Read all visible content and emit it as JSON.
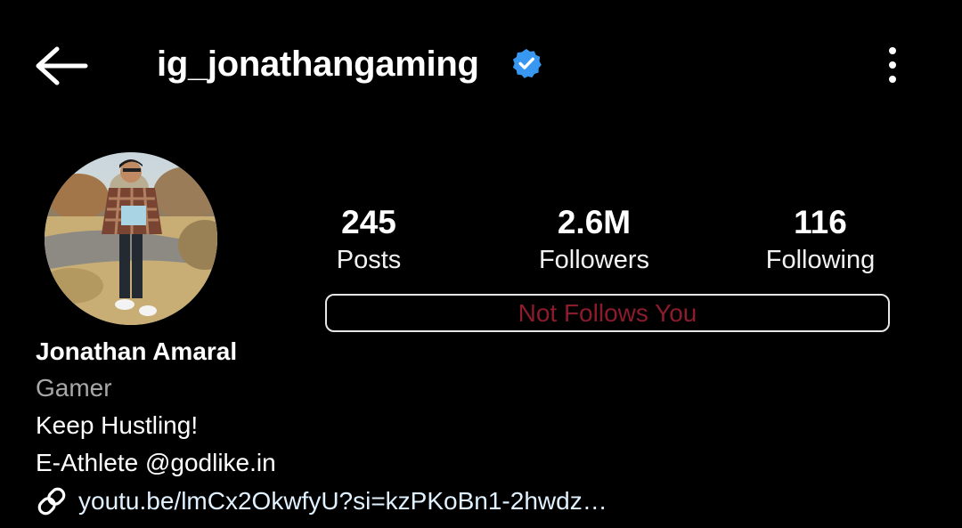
{
  "header": {
    "username": "ig_jonathangaming",
    "back_icon": "arrow-left-icon",
    "verified_icon": "verified-badge-icon",
    "menu_icon": "more-vertical-icon",
    "verified_color": "#3897f0"
  },
  "stats": [
    {
      "value": "245",
      "label": "Posts"
    },
    {
      "value": "2.6M",
      "label": "Followers"
    },
    {
      "value": "116",
      "label": "Following"
    }
  ],
  "follow_status": {
    "label": "Not Follows You",
    "color": "#8c1b2b"
  },
  "profile": {
    "name": "Jonathan Amaral",
    "category": "Gamer",
    "bio_lines": [
      "Keep Hustling!",
      "E-Athlete @godlike.in"
    ],
    "link": "youtu.be/lmCx2OkwfyU?si=kzPKoBn1-2hwdz…",
    "link_icon": "link-icon"
  }
}
